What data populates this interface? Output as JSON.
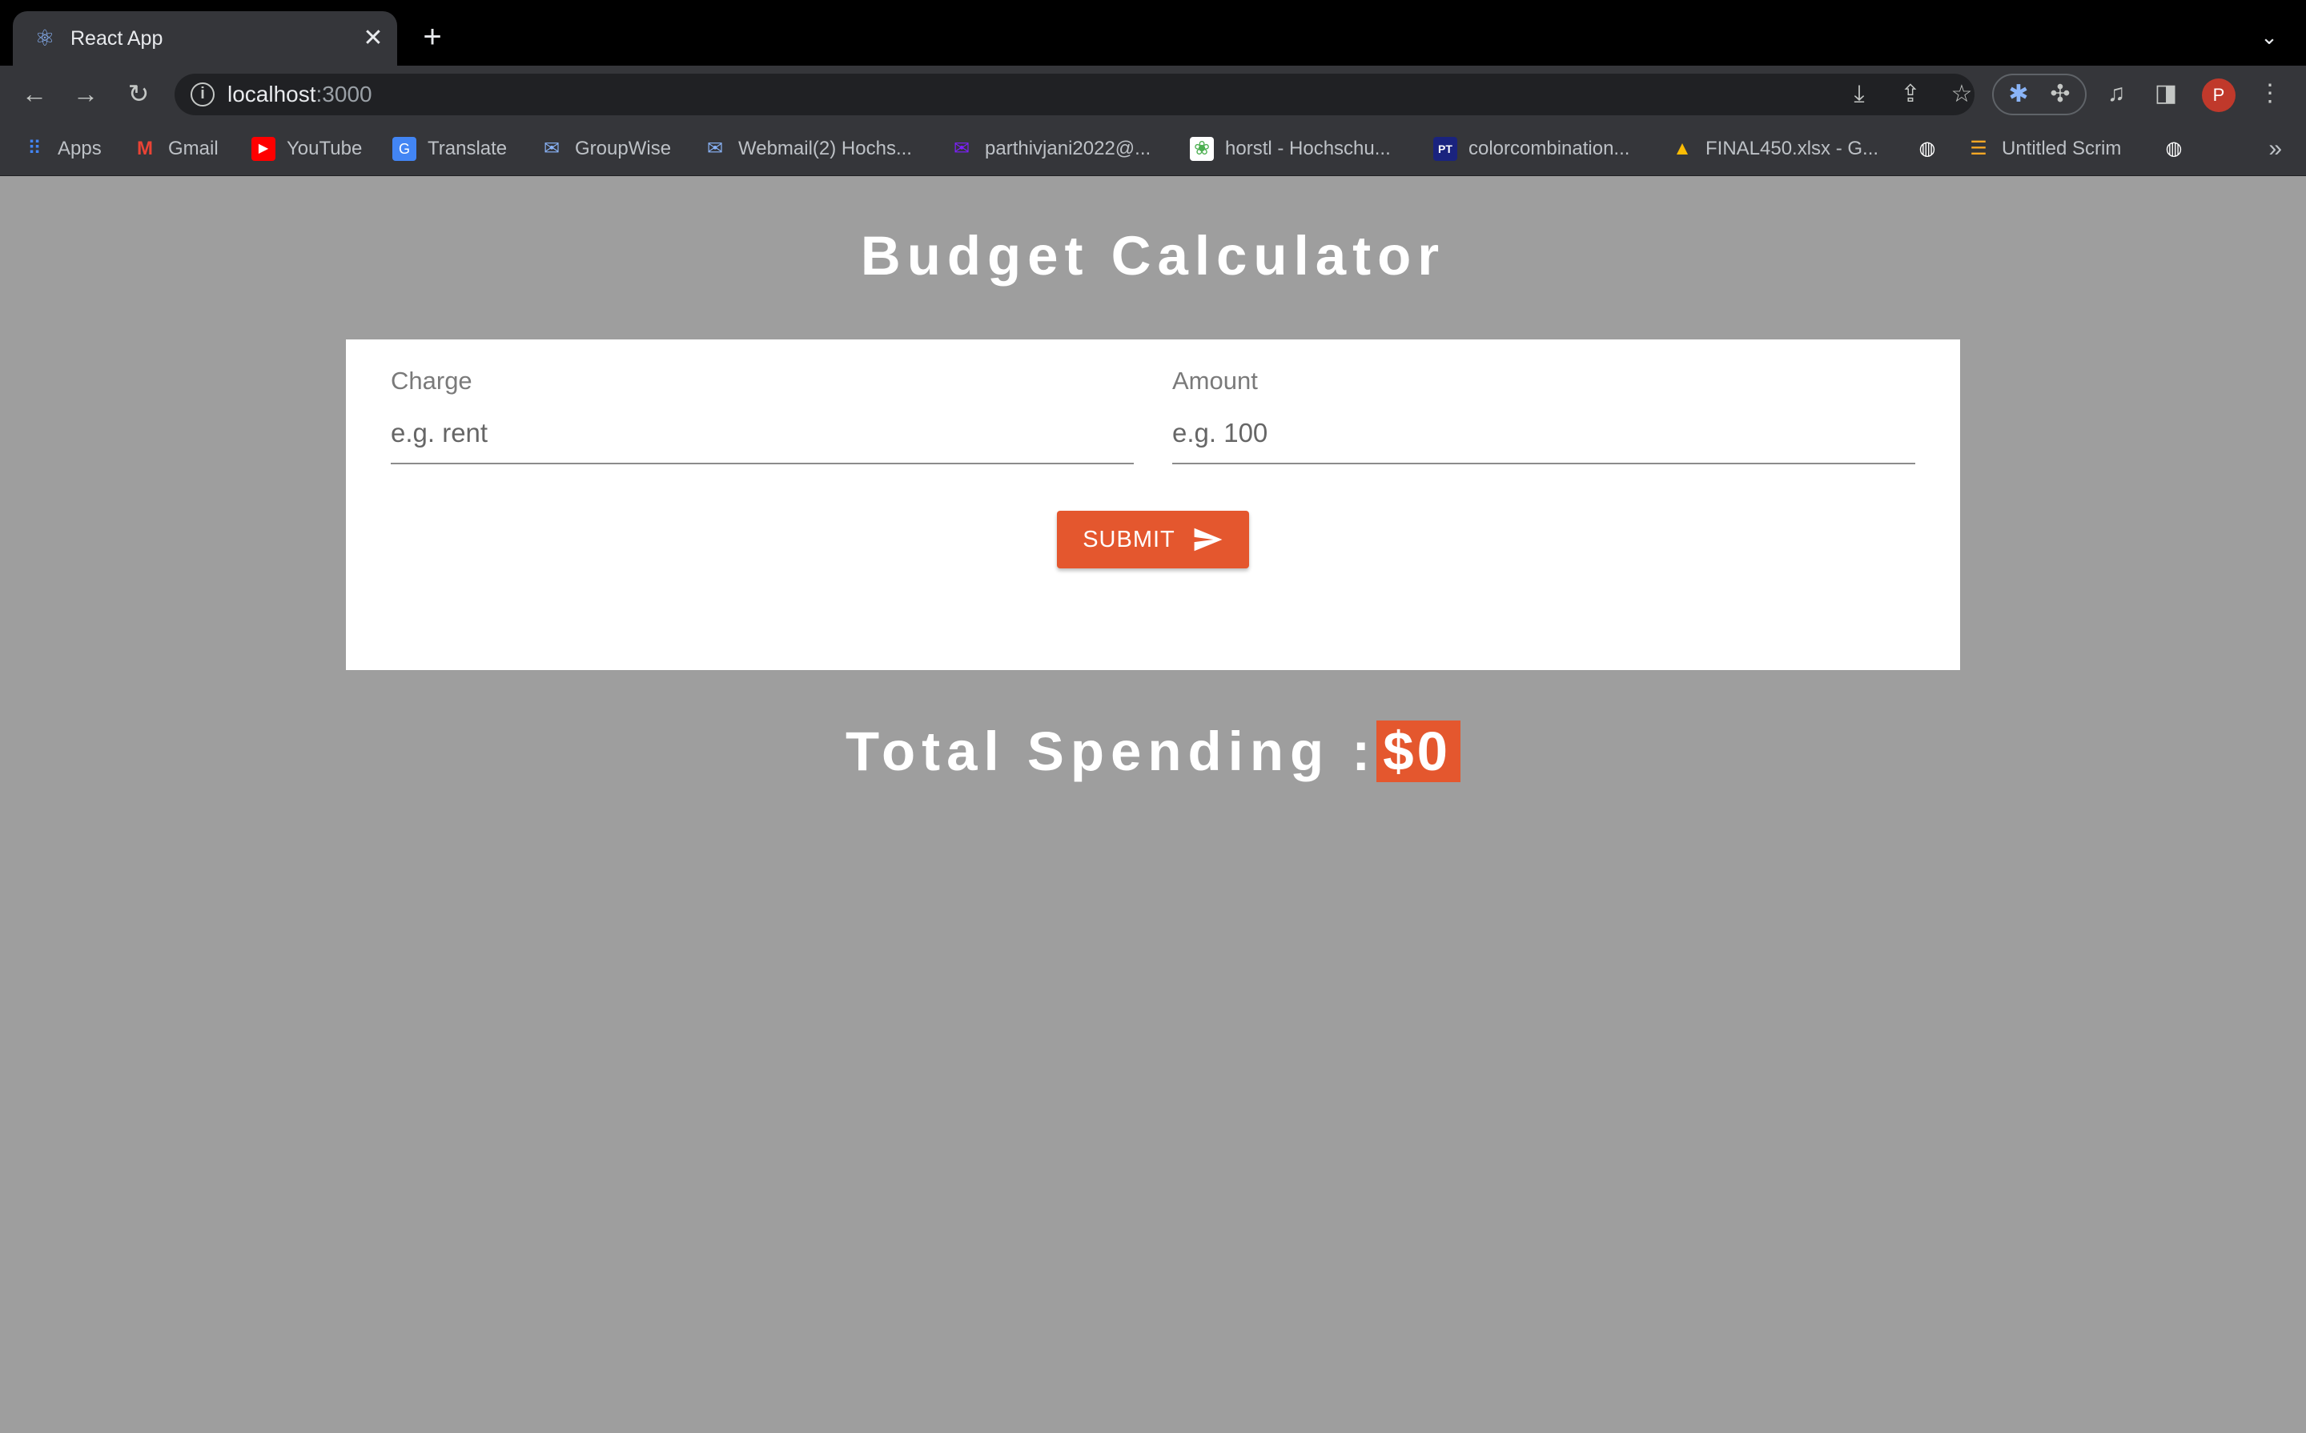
{
  "browser": {
    "tab_title": "React App",
    "url_host": "localhost",
    "url_port": ":3000",
    "bookmarks": [
      {
        "label": "Apps",
        "icon": "apps-grid-icon"
      },
      {
        "label": "Gmail",
        "icon": "gmail-icon"
      },
      {
        "label": "YouTube",
        "icon": "youtube-icon"
      },
      {
        "label": "Translate",
        "icon": "translate-icon"
      },
      {
        "label": "GroupWise",
        "icon": "mail-icon"
      },
      {
        "label": "Webmail(2) Hochs...",
        "icon": "mail-icon"
      },
      {
        "label": "parthivjani2022@...",
        "icon": "yahoo-mail-icon"
      },
      {
        "label": "horstl - Hochschu...",
        "icon": "leaf-icon"
      },
      {
        "label": "colorcombination...",
        "icon": "pt-icon"
      },
      {
        "label": "FINAL450.xlsx - G...",
        "icon": "drive-icon"
      },
      {
        "label": "",
        "icon": "globe-icon"
      },
      {
        "label": "Untitled Scrim",
        "icon": "scrim-icon"
      },
      {
        "label": "",
        "icon": "globe-icon"
      }
    ],
    "avatar_letter": "P"
  },
  "app": {
    "title": "Budget Calculator",
    "charge_label": "Charge",
    "charge_placeholder": "e.g. rent",
    "amount_label": "Amount",
    "amount_placeholder": "e.g. 100",
    "submit_label": "SUBMIT",
    "total_label": "Total Spending :",
    "total_value": "$0"
  },
  "colors": {
    "accent": "#e4572e",
    "page_bg": "#9e9e9e"
  }
}
